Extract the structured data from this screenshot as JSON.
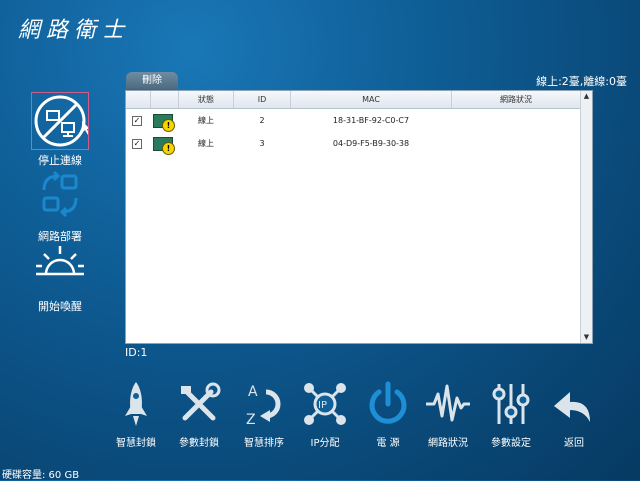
{
  "app": {
    "title": "網路衛士"
  },
  "sidebar": {
    "items": [
      {
        "label": "停止連線",
        "icon": "stop-connection-icon"
      },
      {
        "label": "網路部署",
        "icon": "network-deploy-icon"
      },
      {
        "label": "開始喚醒",
        "icon": "wake-up-icon"
      }
    ]
  },
  "toolbar": {
    "delete_tab": "刪除"
  },
  "status": {
    "text": "線上:2臺,離線:0臺"
  },
  "table": {
    "columns": [
      "",
      "",
      "狀態",
      "ID",
      "MAC",
      "網路狀況"
    ],
    "rows": [
      {
        "checked": "✓",
        "state": "線上",
        "id": "2",
        "mac": "18-31-BF-92-C0-C7",
        "net": ""
      },
      {
        "checked": "✓",
        "state": "線上",
        "id": "3",
        "mac": "04-D9-F5-B9-30-38",
        "net": ""
      }
    ]
  },
  "selection": {
    "id_text": "ID:1"
  },
  "bottom": {
    "buttons": [
      {
        "label": "智慧封鎖",
        "icon": "rocket-icon"
      },
      {
        "label": "參數封鎖",
        "icon": "tools-icon"
      },
      {
        "label": "智慧排序",
        "icon": "sort-az-icon"
      },
      {
        "label": "IP分配",
        "icon": "ip-network-icon"
      },
      {
        "label": "電 源",
        "icon": "power-icon"
      },
      {
        "label": "網路狀況",
        "icon": "pulse-icon"
      },
      {
        "label": "參數設定",
        "icon": "sliders-icon"
      },
      {
        "label": "返回",
        "icon": "back-arrow-icon"
      }
    ]
  },
  "footer": {
    "disk": "硬碟容量: 60 GB"
  },
  "colors": {
    "accent": "#0f5f98",
    "panel": "#ffffff",
    "warn": "#f5d400"
  }
}
